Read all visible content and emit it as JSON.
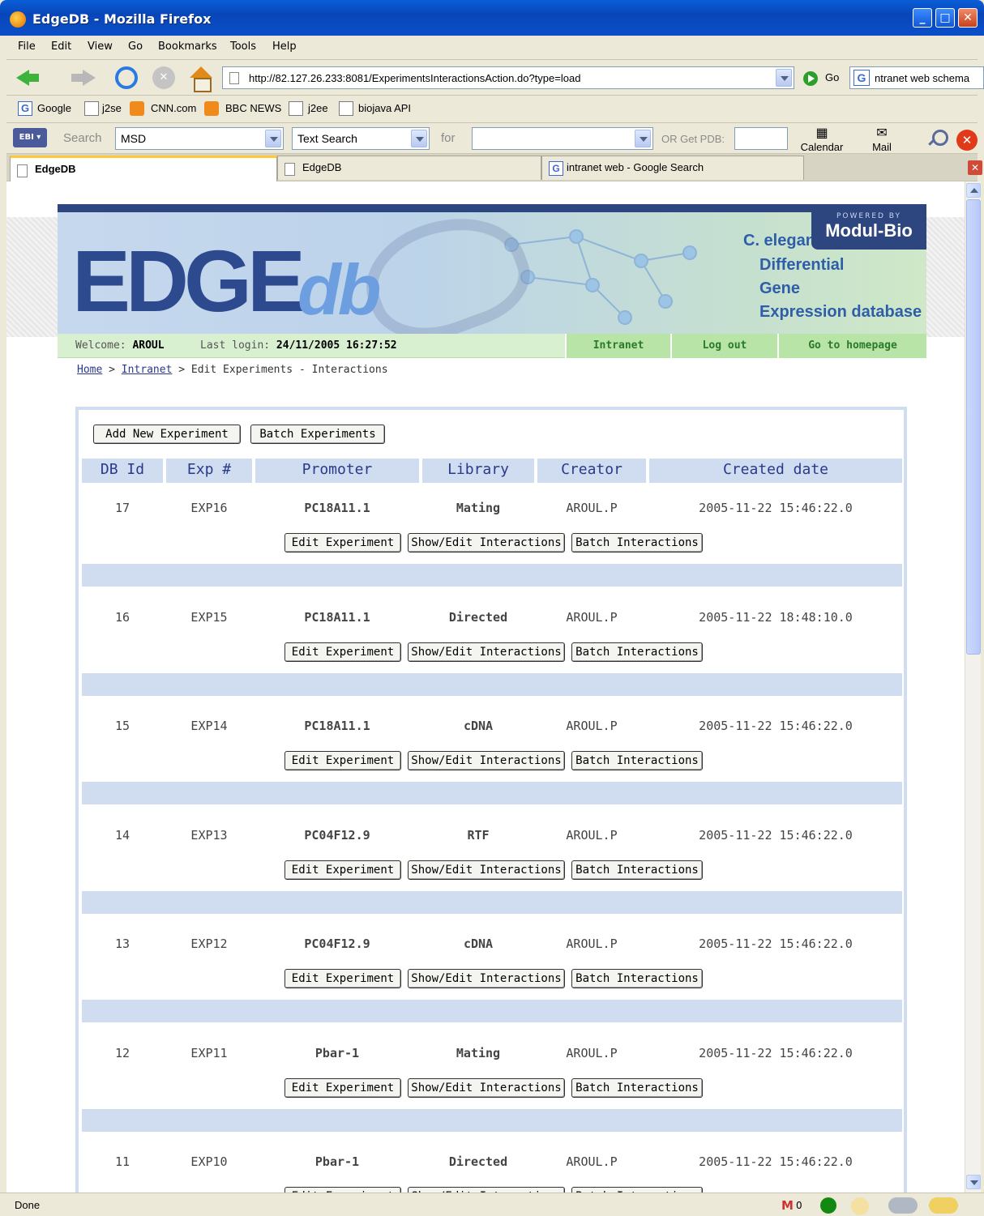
{
  "window": {
    "title": "EdgeDB - Mozilla Firefox"
  },
  "menu": [
    "File",
    "Edit",
    "View",
    "Go",
    "Bookmarks",
    "Tools",
    "Help"
  ],
  "nav": {
    "url": "http://82.127.26.233:8081/ExperimentsInteractionsAction.do?type=load",
    "go_label": "Go",
    "search_text": "ntranet web schema"
  },
  "bookmarks": [
    "Google",
    "j2se",
    "CNN.com",
    "BBC NEWS",
    "j2ee",
    "biojava API"
  ],
  "ebi_toolbar": {
    "search_label": "Search",
    "db_value": "MSD",
    "type_value": "Text Search",
    "for_label": "for",
    "pdb_label": "OR Get PDB:",
    "calendar_label": "Calendar",
    "mail_label": "Mail"
  },
  "tabs": [
    "EdgeDB",
    "EdgeDB",
    "intranet web - Google Search"
  ],
  "banner": {
    "powered": "POWERED BY",
    "brand": "Modul-Bio",
    "edge": "EDGE",
    "db": "db",
    "tag1": "C. elegans",
    "tag2": "Differential",
    "tag3": "Gene",
    "tag4": "Expression database"
  },
  "info": {
    "welcome_label": "Welcome:",
    "user": "AROUL",
    "last_login_label": "Last login:",
    "last_login": "24/11/2005 16:27:52",
    "links": [
      "Intranet",
      "Log out",
      "Go to homepage"
    ]
  },
  "breadcrumb": {
    "home": "Home",
    "intranet": "Intranet",
    "current": "Edit Experiments - Interactions",
    "sep": ">"
  },
  "actions": {
    "add": "Add New Experiment",
    "batch": "Batch Experiments"
  },
  "table": {
    "headers": [
      "DB Id",
      "Exp #",
      "Promoter",
      "Library",
      "Creator",
      "Created date"
    ],
    "row_buttons": [
      "Edit Experiment",
      "Show/Edit Interactions",
      "Batch Interactions"
    ],
    "rows": [
      {
        "id": "17",
        "exp": "EXP16",
        "promoter": "PC18A11.1",
        "library": "Mating",
        "creator": "AROUL.P",
        "date": "2005-11-22 15:46:22.0"
      },
      {
        "id": "16",
        "exp": "EXP15",
        "promoter": "PC18A11.1",
        "library": "Directed",
        "creator": "AROUL.P",
        "date": "2005-11-22 18:48:10.0"
      },
      {
        "id": "15",
        "exp": "EXP14",
        "promoter": "PC18A11.1",
        "library": "cDNA",
        "creator": "AROUL.P",
        "date": "2005-11-22 15:46:22.0"
      },
      {
        "id": "14",
        "exp": "EXP13",
        "promoter": "PC04F12.9",
        "library": "RTF",
        "creator": "AROUL.P",
        "date": "2005-11-22 15:46:22.0"
      },
      {
        "id": "13",
        "exp": "EXP12",
        "promoter": "PC04F12.9",
        "library": "cDNA",
        "creator": "AROUL.P",
        "date": "2005-11-22 15:46:22.0"
      },
      {
        "id": "12",
        "exp": "EXP11",
        "promoter": "Pbar-1",
        "library": "Mating",
        "creator": "AROUL.P",
        "date": "2005-11-22 15:46:22.0"
      },
      {
        "id": "11",
        "exp": "EXP10",
        "promoter": "Pbar-1",
        "library": "Directed",
        "creator": "AROUL.P",
        "date": "2005-11-22 15:46:22.0"
      }
    ]
  },
  "status": {
    "text": "Done",
    "mail_count": "0"
  },
  "colors": {
    "header_bg": "#d0dcf0",
    "header_text": "#2a3a8a",
    "titlebar": "#0846b8",
    "infobar": "#d8f0d0"
  }
}
